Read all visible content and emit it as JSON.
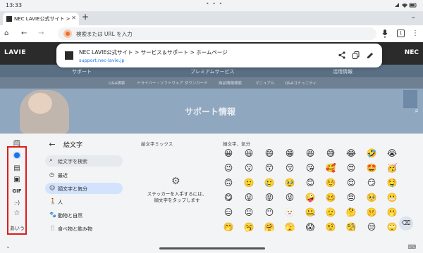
{
  "status_bar": {
    "time": "13:33",
    "dots": "• • •"
  },
  "tab": {
    "title": "NEC LAVIE公式サイト > サ",
    "close": "✕",
    "new_tab": "+"
  },
  "toolbar": {
    "home": "⌂",
    "back": "←",
    "forward": "→",
    "omnibox_placeholder": "検索または URL を入力",
    "mic": "🎤",
    "tab_count": "1",
    "menu": "⋮"
  },
  "page": {
    "logo": "LAVIE",
    "nec": "NEC",
    "nav": [
      "サポート",
      "プレミアムサービス",
      "活用情報"
    ],
    "subnav": [
      "Q&A検索",
      "ドライバー・ソフトウェア ダウンロード",
      "商品情報検索",
      "マニュアル",
      "Q&Aコミュニティ"
    ],
    "hero_title": "サポート情報"
  },
  "popup": {
    "title": "NEC LAVIE公式サイト > サービス＆サポート > ホームページ",
    "url": "support.nec-lavie.jp"
  },
  "keyboard": {
    "rail": [
      "🗒",
      "🙂",
      "▤",
      "▣",
      "GIF",
      ":-)",
      "☆"
    ],
    "ime_label": "あいう",
    "header": "絵文字",
    "search_placeholder": "絵文字を検索",
    "categories": [
      {
        "icon": "◷",
        "label": "最近"
      },
      {
        "icon": "☺",
        "label": "顔文字と気分"
      },
      {
        "icon": "🚶",
        "label": "人"
      },
      {
        "icon": "🐾",
        "label": "動物と自然"
      },
      {
        "icon": "🍴",
        "label": "食べ物と飲み物"
      }
    ],
    "mix_title": "絵文字ミックス",
    "mix_message": "ステッカーを入手するには、顔文字をタップします",
    "emoji_section": "顔文字、気分",
    "emojis": [
      [
        "😀",
        "😃",
        "😄",
        "😁",
        "😆",
        "😅",
        "😂",
        "🤣",
        "😭"
      ],
      [
        "😉",
        "😗",
        "😙",
        "😚",
        "😘",
        "🥰",
        "😍",
        "🤩",
        "🥳"
      ],
      [
        "🙃",
        "🙂",
        "🥲",
        "🥹",
        "😊",
        "☺️",
        "😌",
        "😏",
        "🤤"
      ],
      [
        "😋",
        "😛",
        "😝",
        "😜",
        "🤪",
        "🥴",
        "😔",
        "🥺",
        "😬"
      ],
      [
        "😑",
        "😐",
        "😶",
        "🫥",
        "🤐",
        "🫡",
        "🤔",
        "🤫",
        "🫢"
      ],
      [
        "🤭",
        "🥱",
        "🤗",
        "🫣",
        "😱",
        "🤨",
        "🧐",
        "😒",
        "🙄"
      ]
    ],
    "backspace": "⌫"
  },
  "nav": {
    "collapse": "⌄",
    "keyboard_switch": "⌨"
  },
  "colors": {
    "accent": "#1a73e8",
    "highlight": "#e01b1b",
    "site_header": "#2b2b2b"
  }
}
